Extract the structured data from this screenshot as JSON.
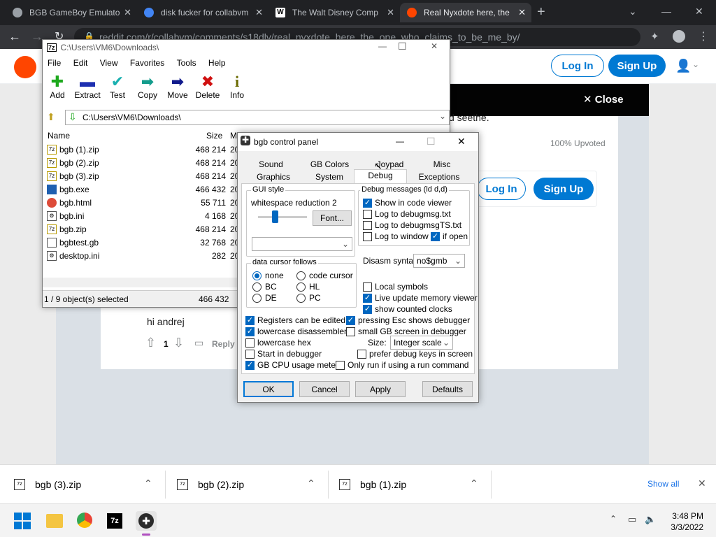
{
  "browser": {
    "tabs": [
      {
        "title": "BGB GameBoy Emulato",
        "color": "#9aa0a6"
      },
      {
        "title": "disk fucker for collabvm",
        "color": "#4285f4"
      },
      {
        "title": "The Walt Disney Comp",
        "color": "#ffffff"
      },
      {
        "title": "Real Nyxdote here, the",
        "color": "#ff4500",
        "active": true
      }
    ],
    "new_tab": "+",
    "address": "reddit.com/r/collabvm/comments/s18dlv/real_nyxdote_here_the_one_who_claims_to_be_me_by/"
  },
  "reddit": {
    "login": "Log In",
    "signup": "Sign Up",
    "close": "Close",
    "snippet": "d seethe.",
    "upvoted": "100% Upvoted",
    "login2": "Log In",
    "signup2": "Sign Up",
    "comment_text": "hi andrej",
    "vote_count": "1",
    "reply": "Reply"
  },
  "zip": {
    "path_title": "C:\\Users\\VM6\\Downloads\\",
    "menu": [
      "File",
      "Edit",
      "View",
      "Favorites",
      "Tools",
      "Help"
    ],
    "toolbar": [
      "Add",
      "Extract",
      "Test",
      "Copy",
      "Move",
      "Delete",
      "Info"
    ],
    "address": "C:\\Users\\VM6\\Downloads\\",
    "columns": {
      "name": "Name",
      "size": "Size",
      "modified": "M"
    },
    "files": [
      {
        "name": "bgb (1).zip",
        "size": "468 214",
        "mod": "20"
      },
      {
        "name": "bgb (2).zip",
        "size": "468 214",
        "mod": "20"
      },
      {
        "name": "bgb (3).zip",
        "size": "468 214",
        "mod": "20"
      },
      {
        "name": "bgb.exe",
        "size": "466 432",
        "mod": "20"
      },
      {
        "name": "bgb.html",
        "size": "55 711",
        "mod": "20"
      },
      {
        "name": "bgb.ini",
        "size": "4 168",
        "mod": "20"
      },
      {
        "name": "bgb.zip",
        "size": "468 214",
        "mod": "20"
      },
      {
        "name": "bgbtest.gb",
        "size": "32 768",
        "mod": "20"
      },
      {
        "name": "desktop.ini",
        "size": "282",
        "mod": "20"
      }
    ],
    "status_selected": "1 / 9 object(s) selected",
    "status_size": "466 432"
  },
  "bgb": {
    "title": "bgb control panel",
    "tabs_row1": [
      "Sound",
      "GB Colors",
      "Joypad",
      "Misc"
    ],
    "tabs_row2": [
      "Graphics",
      "System",
      "Debug",
      "Exceptions"
    ],
    "gui_style": "GUI style",
    "whitespace_label": "whitespace reduction",
    "whitespace_value": "2",
    "font_button": "Font...",
    "data_cursor": "data cursor follows",
    "radios": [
      {
        "label": "none",
        "on": true
      },
      {
        "label": "code cursor",
        "on": false
      },
      {
        "label": "BC",
        "on": false
      },
      {
        "label": "HL",
        "on": false
      },
      {
        "label": "DE",
        "on": false
      },
      {
        "label": "PC",
        "on": false
      }
    ],
    "debug_messages": "Debug messages (ld d,d)",
    "msg_checks": [
      {
        "label": "Show in code viewer",
        "on": true
      },
      {
        "label": "Log to debugmsg.txt",
        "on": false
      },
      {
        "label": "Log to debugmsgTS.txt",
        "on": false
      },
      {
        "label": "Log to window",
        "on": false
      },
      {
        "label": "if open",
        "on": true
      }
    ],
    "disasm_label": "Disasm syntax:",
    "disasm_value": "no$gmb",
    "right_checks": [
      {
        "label": "Local symbols",
        "on": false
      },
      {
        "label": "Live update memory viewer",
        "on": true
      },
      {
        "label": "show counted clocks",
        "on": true
      }
    ],
    "bottom_checks": [
      {
        "label": "Registers can be edited",
        "on": true
      },
      {
        "label": "pressing Esc shows debugger",
        "on": true
      },
      {
        "label": "lowercase disassembler",
        "on": true
      },
      {
        "label": "small GB screen in debugger",
        "on": false
      },
      {
        "label": "lowercase hex",
        "on": false
      },
      {
        "label": "Start in debugger",
        "on": false
      },
      {
        "label": "prefer debug keys in screen",
        "on": false
      },
      {
        "label": "GB CPU usage meter",
        "on": true
      },
      {
        "label": "Only run if using a run command",
        "on": false
      }
    ],
    "size_label": "Size:",
    "size_value": "Integer scale",
    "buttons": [
      "OK",
      "Cancel",
      "Apply",
      "Defaults"
    ]
  },
  "downloads": {
    "items": [
      "bgb (3).zip",
      "bgb (2).zip",
      "bgb (1).zip"
    ],
    "show_all": "Show all"
  },
  "taskbar": {
    "time": "3:48 PM",
    "date": "3/3/2022"
  }
}
